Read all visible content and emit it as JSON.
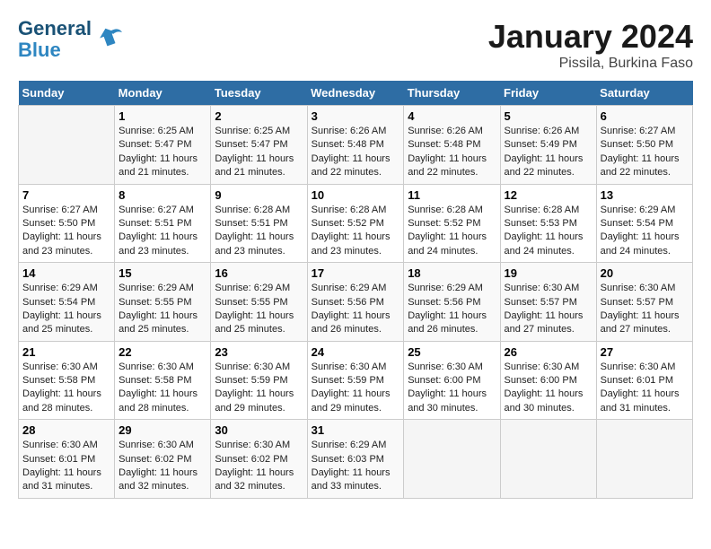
{
  "header": {
    "logo_general": "General",
    "logo_blue": "Blue",
    "month_title": "January 2024",
    "location": "Pissila, Burkina Faso"
  },
  "weekdays": [
    "Sunday",
    "Monday",
    "Tuesday",
    "Wednesday",
    "Thursday",
    "Friday",
    "Saturday"
  ],
  "weeks": [
    [
      {
        "day": "",
        "info": ""
      },
      {
        "day": "1",
        "info": "Sunrise: 6:25 AM\nSunset: 5:47 PM\nDaylight: 11 hours\nand 21 minutes."
      },
      {
        "day": "2",
        "info": "Sunrise: 6:25 AM\nSunset: 5:47 PM\nDaylight: 11 hours\nand 21 minutes."
      },
      {
        "day": "3",
        "info": "Sunrise: 6:26 AM\nSunset: 5:48 PM\nDaylight: 11 hours\nand 22 minutes."
      },
      {
        "day": "4",
        "info": "Sunrise: 6:26 AM\nSunset: 5:48 PM\nDaylight: 11 hours\nand 22 minutes."
      },
      {
        "day": "5",
        "info": "Sunrise: 6:26 AM\nSunset: 5:49 PM\nDaylight: 11 hours\nand 22 minutes."
      },
      {
        "day": "6",
        "info": "Sunrise: 6:27 AM\nSunset: 5:50 PM\nDaylight: 11 hours\nand 22 minutes."
      }
    ],
    [
      {
        "day": "7",
        "info": "Sunrise: 6:27 AM\nSunset: 5:50 PM\nDaylight: 11 hours\nand 23 minutes."
      },
      {
        "day": "8",
        "info": "Sunrise: 6:27 AM\nSunset: 5:51 PM\nDaylight: 11 hours\nand 23 minutes."
      },
      {
        "day": "9",
        "info": "Sunrise: 6:28 AM\nSunset: 5:51 PM\nDaylight: 11 hours\nand 23 minutes."
      },
      {
        "day": "10",
        "info": "Sunrise: 6:28 AM\nSunset: 5:52 PM\nDaylight: 11 hours\nand 23 minutes."
      },
      {
        "day": "11",
        "info": "Sunrise: 6:28 AM\nSunset: 5:52 PM\nDaylight: 11 hours\nand 24 minutes."
      },
      {
        "day": "12",
        "info": "Sunrise: 6:28 AM\nSunset: 5:53 PM\nDaylight: 11 hours\nand 24 minutes."
      },
      {
        "day": "13",
        "info": "Sunrise: 6:29 AM\nSunset: 5:54 PM\nDaylight: 11 hours\nand 24 minutes."
      }
    ],
    [
      {
        "day": "14",
        "info": "Sunrise: 6:29 AM\nSunset: 5:54 PM\nDaylight: 11 hours\nand 25 minutes."
      },
      {
        "day": "15",
        "info": "Sunrise: 6:29 AM\nSunset: 5:55 PM\nDaylight: 11 hours\nand 25 minutes."
      },
      {
        "day": "16",
        "info": "Sunrise: 6:29 AM\nSunset: 5:55 PM\nDaylight: 11 hours\nand 25 minutes."
      },
      {
        "day": "17",
        "info": "Sunrise: 6:29 AM\nSunset: 5:56 PM\nDaylight: 11 hours\nand 26 minutes."
      },
      {
        "day": "18",
        "info": "Sunrise: 6:29 AM\nSunset: 5:56 PM\nDaylight: 11 hours\nand 26 minutes."
      },
      {
        "day": "19",
        "info": "Sunrise: 6:30 AM\nSunset: 5:57 PM\nDaylight: 11 hours\nand 27 minutes."
      },
      {
        "day": "20",
        "info": "Sunrise: 6:30 AM\nSunset: 5:57 PM\nDaylight: 11 hours\nand 27 minutes."
      }
    ],
    [
      {
        "day": "21",
        "info": "Sunrise: 6:30 AM\nSunset: 5:58 PM\nDaylight: 11 hours\nand 28 minutes."
      },
      {
        "day": "22",
        "info": "Sunrise: 6:30 AM\nSunset: 5:58 PM\nDaylight: 11 hours\nand 28 minutes."
      },
      {
        "day": "23",
        "info": "Sunrise: 6:30 AM\nSunset: 5:59 PM\nDaylight: 11 hours\nand 29 minutes."
      },
      {
        "day": "24",
        "info": "Sunrise: 6:30 AM\nSunset: 5:59 PM\nDaylight: 11 hours\nand 29 minutes."
      },
      {
        "day": "25",
        "info": "Sunrise: 6:30 AM\nSunset: 6:00 PM\nDaylight: 11 hours\nand 30 minutes."
      },
      {
        "day": "26",
        "info": "Sunrise: 6:30 AM\nSunset: 6:00 PM\nDaylight: 11 hours\nand 30 minutes."
      },
      {
        "day": "27",
        "info": "Sunrise: 6:30 AM\nSunset: 6:01 PM\nDaylight: 11 hours\nand 31 minutes."
      }
    ],
    [
      {
        "day": "28",
        "info": "Sunrise: 6:30 AM\nSunset: 6:01 PM\nDaylight: 11 hours\nand 31 minutes."
      },
      {
        "day": "29",
        "info": "Sunrise: 6:30 AM\nSunset: 6:02 PM\nDaylight: 11 hours\nand 32 minutes."
      },
      {
        "day": "30",
        "info": "Sunrise: 6:30 AM\nSunset: 6:02 PM\nDaylight: 11 hours\nand 32 minutes."
      },
      {
        "day": "31",
        "info": "Sunrise: 6:29 AM\nSunset: 6:03 PM\nDaylight: 11 hours\nand 33 minutes."
      },
      {
        "day": "",
        "info": ""
      },
      {
        "day": "",
        "info": ""
      },
      {
        "day": "",
        "info": ""
      }
    ]
  ]
}
